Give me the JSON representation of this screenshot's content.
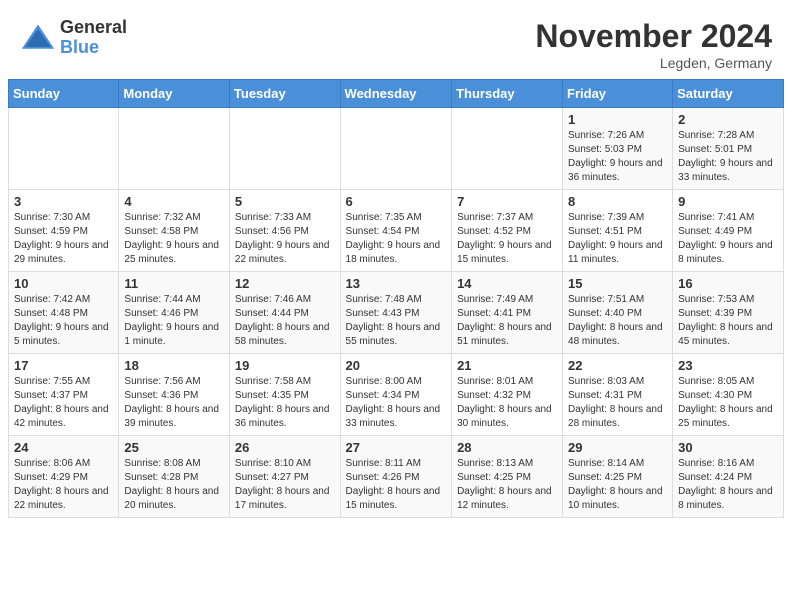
{
  "header": {
    "logo_general": "General",
    "logo_blue": "Blue",
    "month_title": "November 2024",
    "location": "Legden, Germany"
  },
  "days_of_week": [
    "Sunday",
    "Monday",
    "Tuesday",
    "Wednesday",
    "Thursday",
    "Friday",
    "Saturday"
  ],
  "weeks": [
    [
      {
        "day": "",
        "info": ""
      },
      {
        "day": "",
        "info": ""
      },
      {
        "day": "",
        "info": ""
      },
      {
        "day": "",
        "info": ""
      },
      {
        "day": "",
        "info": ""
      },
      {
        "day": "1",
        "info": "Sunrise: 7:26 AM\nSunset: 5:03 PM\nDaylight: 9 hours and 36 minutes."
      },
      {
        "day": "2",
        "info": "Sunrise: 7:28 AM\nSunset: 5:01 PM\nDaylight: 9 hours and 33 minutes."
      }
    ],
    [
      {
        "day": "3",
        "info": "Sunrise: 7:30 AM\nSunset: 4:59 PM\nDaylight: 9 hours and 29 minutes."
      },
      {
        "day": "4",
        "info": "Sunrise: 7:32 AM\nSunset: 4:58 PM\nDaylight: 9 hours and 25 minutes."
      },
      {
        "day": "5",
        "info": "Sunrise: 7:33 AM\nSunset: 4:56 PM\nDaylight: 9 hours and 22 minutes."
      },
      {
        "day": "6",
        "info": "Sunrise: 7:35 AM\nSunset: 4:54 PM\nDaylight: 9 hours and 18 minutes."
      },
      {
        "day": "7",
        "info": "Sunrise: 7:37 AM\nSunset: 4:52 PM\nDaylight: 9 hours and 15 minutes."
      },
      {
        "day": "8",
        "info": "Sunrise: 7:39 AM\nSunset: 4:51 PM\nDaylight: 9 hours and 11 minutes."
      },
      {
        "day": "9",
        "info": "Sunrise: 7:41 AM\nSunset: 4:49 PM\nDaylight: 9 hours and 8 minutes."
      }
    ],
    [
      {
        "day": "10",
        "info": "Sunrise: 7:42 AM\nSunset: 4:48 PM\nDaylight: 9 hours and 5 minutes."
      },
      {
        "day": "11",
        "info": "Sunrise: 7:44 AM\nSunset: 4:46 PM\nDaylight: 9 hours and 1 minute."
      },
      {
        "day": "12",
        "info": "Sunrise: 7:46 AM\nSunset: 4:44 PM\nDaylight: 8 hours and 58 minutes."
      },
      {
        "day": "13",
        "info": "Sunrise: 7:48 AM\nSunset: 4:43 PM\nDaylight: 8 hours and 55 minutes."
      },
      {
        "day": "14",
        "info": "Sunrise: 7:49 AM\nSunset: 4:41 PM\nDaylight: 8 hours and 51 minutes."
      },
      {
        "day": "15",
        "info": "Sunrise: 7:51 AM\nSunset: 4:40 PM\nDaylight: 8 hours and 48 minutes."
      },
      {
        "day": "16",
        "info": "Sunrise: 7:53 AM\nSunset: 4:39 PM\nDaylight: 8 hours and 45 minutes."
      }
    ],
    [
      {
        "day": "17",
        "info": "Sunrise: 7:55 AM\nSunset: 4:37 PM\nDaylight: 8 hours and 42 minutes."
      },
      {
        "day": "18",
        "info": "Sunrise: 7:56 AM\nSunset: 4:36 PM\nDaylight: 8 hours and 39 minutes."
      },
      {
        "day": "19",
        "info": "Sunrise: 7:58 AM\nSunset: 4:35 PM\nDaylight: 8 hours and 36 minutes."
      },
      {
        "day": "20",
        "info": "Sunrise: 8:00 AM\nSunset: 4:34 PM\nDaylight: 8 hours and 33 minutes."
      },
      {
        "day": "21",
        "info": "Sunrise: 8:01 AM\nSunset: 4:32 PM\nDaylight: 8 hours and 30 minutes."
      },
      {
        "day": "22",
        "info": "Sunrise: 8:03 AM\nSunset: 4:31 PM\nDaylight: 8 hours and 28 minutes."
      },
      {
        "day": "23",
        "info": "Sunrise: 8:05 AM\nSunset: 4:30 PM\nDaylight: 8 hours and 25 minutes."
      }
    ],
    [
      {
        "day": "24",
        "info": "Sunrise: 8:06 AM\nSunset: 4:29 PM\nDaylight: 8 hours and 22 minutes."
      },
      {
        "day": "25",
        "info": "Sunrise: 8:08 AM\nSunset: 4:28 PM\nDaylight: 8 hours and 20 minutes."
      },
      {
        "day": "26",
        "info": "Sunrise: 8:10 AM\nSunset: 4:27 PM\nDaylight: 8 hours and 17 minutes."
      },
      {
        "day": "27",
        "info": "Sunrise: 8:11 AM\nSunset: 4:26 PM\nDaylight: 8 hours and 15 minutes."
      },
      {
        "day": "28",
        "info": "Sunrise: 8:13 AM\nSunset: 4:25 PM\nDaylight: 8 hours and 12 minutes."
      },
      {
        "day": "29",
        "info": "Sunrise: 8:14 AM\nSunset: 4:25 PM\nDaylight: 8 hours and 10 minutes."
      },
      {
        "day": "30",
        "info": "Sunrise: 8:16 AM\nSunset: 4:24 PM\nDaylight: 8 hours and 8 minutes."
      }
    ]
  ]
}
